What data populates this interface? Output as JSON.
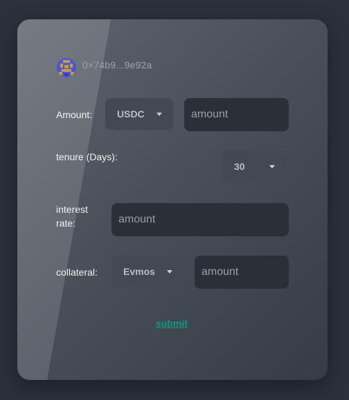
{
  "wallet": {
    "address": "0×74b9...9e92a"
  },
  "amount": {
    "label": "Amount:",
    "token": "USDC",
    "placeholder": "amount"
  },
  "tenure": {
    "label": "tenure (Days):",
    "value": "30"
  },
  "interest": {
    "label_line1": "interest",
    "label_line2": "rate:",
    "placeholder": "amount"
  },
  "collateral": {
    "label": "collateral:",
    "token": "Evmos",
    "placeholder": "amount"
  },
  "submit_label": "submit"
}
